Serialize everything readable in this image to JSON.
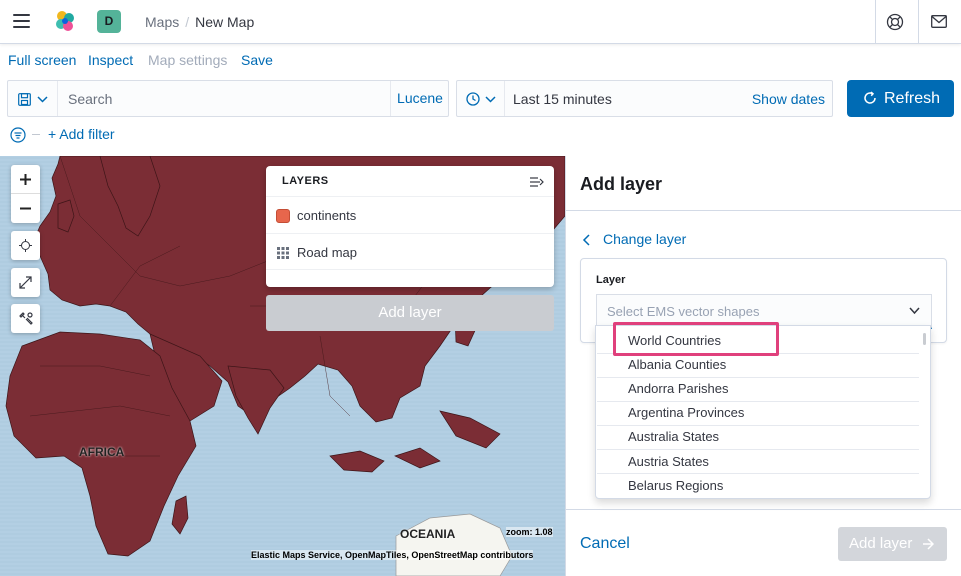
{
  "header": {
    "avatar_letter": "D",
    "breadcrumb_parent": "Maps",
    "breadcrumb_separator": "/",
    "breadcrumb_current": "New Map"
  },
  "menu": {
    "full_screen": "Full screen",
    "inspect": "Inspect",
    "map_settings": "Map settings",
    "save": "Save"
  },
  "query": {
    "search_placeholder": "Search",
    "language": "Lucene",
    "time_range": "Last 15 minutes",
    "show_dates": "Show dates",
    "refresh": "Refresh",
    "add_filter": "+ Add filter"
  },
  "map": {
    "layers_title": "LAYERS",
    "layers": [
      {
        "name": "continents",
        "color": "#e7664c"
      },
      {
        "name": "Road map",
        "icon": "grid-icon"
      }
    ],
    "add_layer_button": "Add layer",
    "labels": {
      "africa": "AFRICA",
      "oceania": "OCEANIA"
    },
    "zoom": "zoom: 1.08",
    "attribution": "Elastic Maps Service, OpenMapTiles, OpenStreetMap contributors",
    "land_color": "#7b2d35",
    "water_color": "#b3cfe3"
  },
  "side_panel": {
    "title": "Add layer",
    "change_layer": "Change layer",
    "field_label": "Layer",
    "combo_placeholder": "Select EMS vector shapes",
    "options": [
      "World Countries",
      "Albania Counties",
      "Andorra Parishes",
      "Argentina Provinces",
      "Australia States",
      "Austria States",
      "Belarus Regions"
    ],
    "cancel": "Cancel",
    "add_layer": "Add layer"
  },
  "colors": {
    "primary": "#006bb4",
    "highlight": "#e0407c"
  }
}
